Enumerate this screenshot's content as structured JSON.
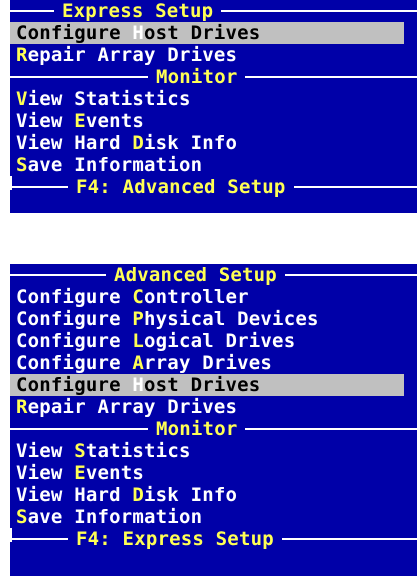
{
  "express_panel": {
    "title": "Express Setup",
    "items": [
      {
        "pre": "Configure ",
        "hot": "H",
        "post": "ost Drives",
        "selected": true
      },
      {
        "pre": "",
        "hot": "R",
        "post": "epair Array Drives",
        "selected": false
      }
    ],
    "monitor_title": "Monitor",
    "monitor_items": [
      {
        "pre": "",
        "hot": "V",
        "post": "iew Statistics"
      },
      {
        "pre": "View ",
        "hot": "E",
        "post": "vents"
      },
      {
        "pre": "View Hard ",
        "hot": "D",
        "post": "isk Info"
      },
      {
        "pre": "",
        "hot": "S",
        "post": "ave Information"
      }
    ],
    "footer": "F4: Advanced Setup"
  },
  "advanced_panel": {
    "title": "Advanced Setup",
    "items": [
      {
        "pre": "Configure ",
        "hot": "C",
        "post": "ontroller",
        "selected": false
      },
      {
        "pre": "Configure ",
        "hot": "P",
        "post": "hysical Devices",
        "selected": false
      },
      {
        "pre": "Configure ",
        "hot": "L",
        "post": "ogical Drives",
        "selected": false
      },
      {
        "pre": "Configure ",
        "hot": "A",
        "post": "rray Drives",
        "selected": false
      },
      {
        "pre": "Configure ",
        "hot": "H",
        "post": "ost Drives",
        "selected": true
      },
      {
        "pre": "",
        "hot": "R",
        "post": "epair Array Drives",
        "selected": false
      }
    ],
    "monitor_title": "Monitor",
    "monitor_items": [
      {
        "pre": "View ",
        "hot": "S",
        "post": "tatistics"
      },
      {
        "pre": "View ",
        "hot": "E",
        "post": "vents"
      },
      {
        "pre": "View Hard ",
        "hot": "D",
        "post": "isk Info"
      },
      {
        "pre": "",
        "hot": "S",
        "post": "ave Information"
      }
    ],
    "footer": "F4: Express Setup"
  },
  "colors": {
    "background": "#0000a8",
    "text": "#ffffff",
    "hotkey": "#ffff54",
    "selection": "#c0c0c0"
  }
}
